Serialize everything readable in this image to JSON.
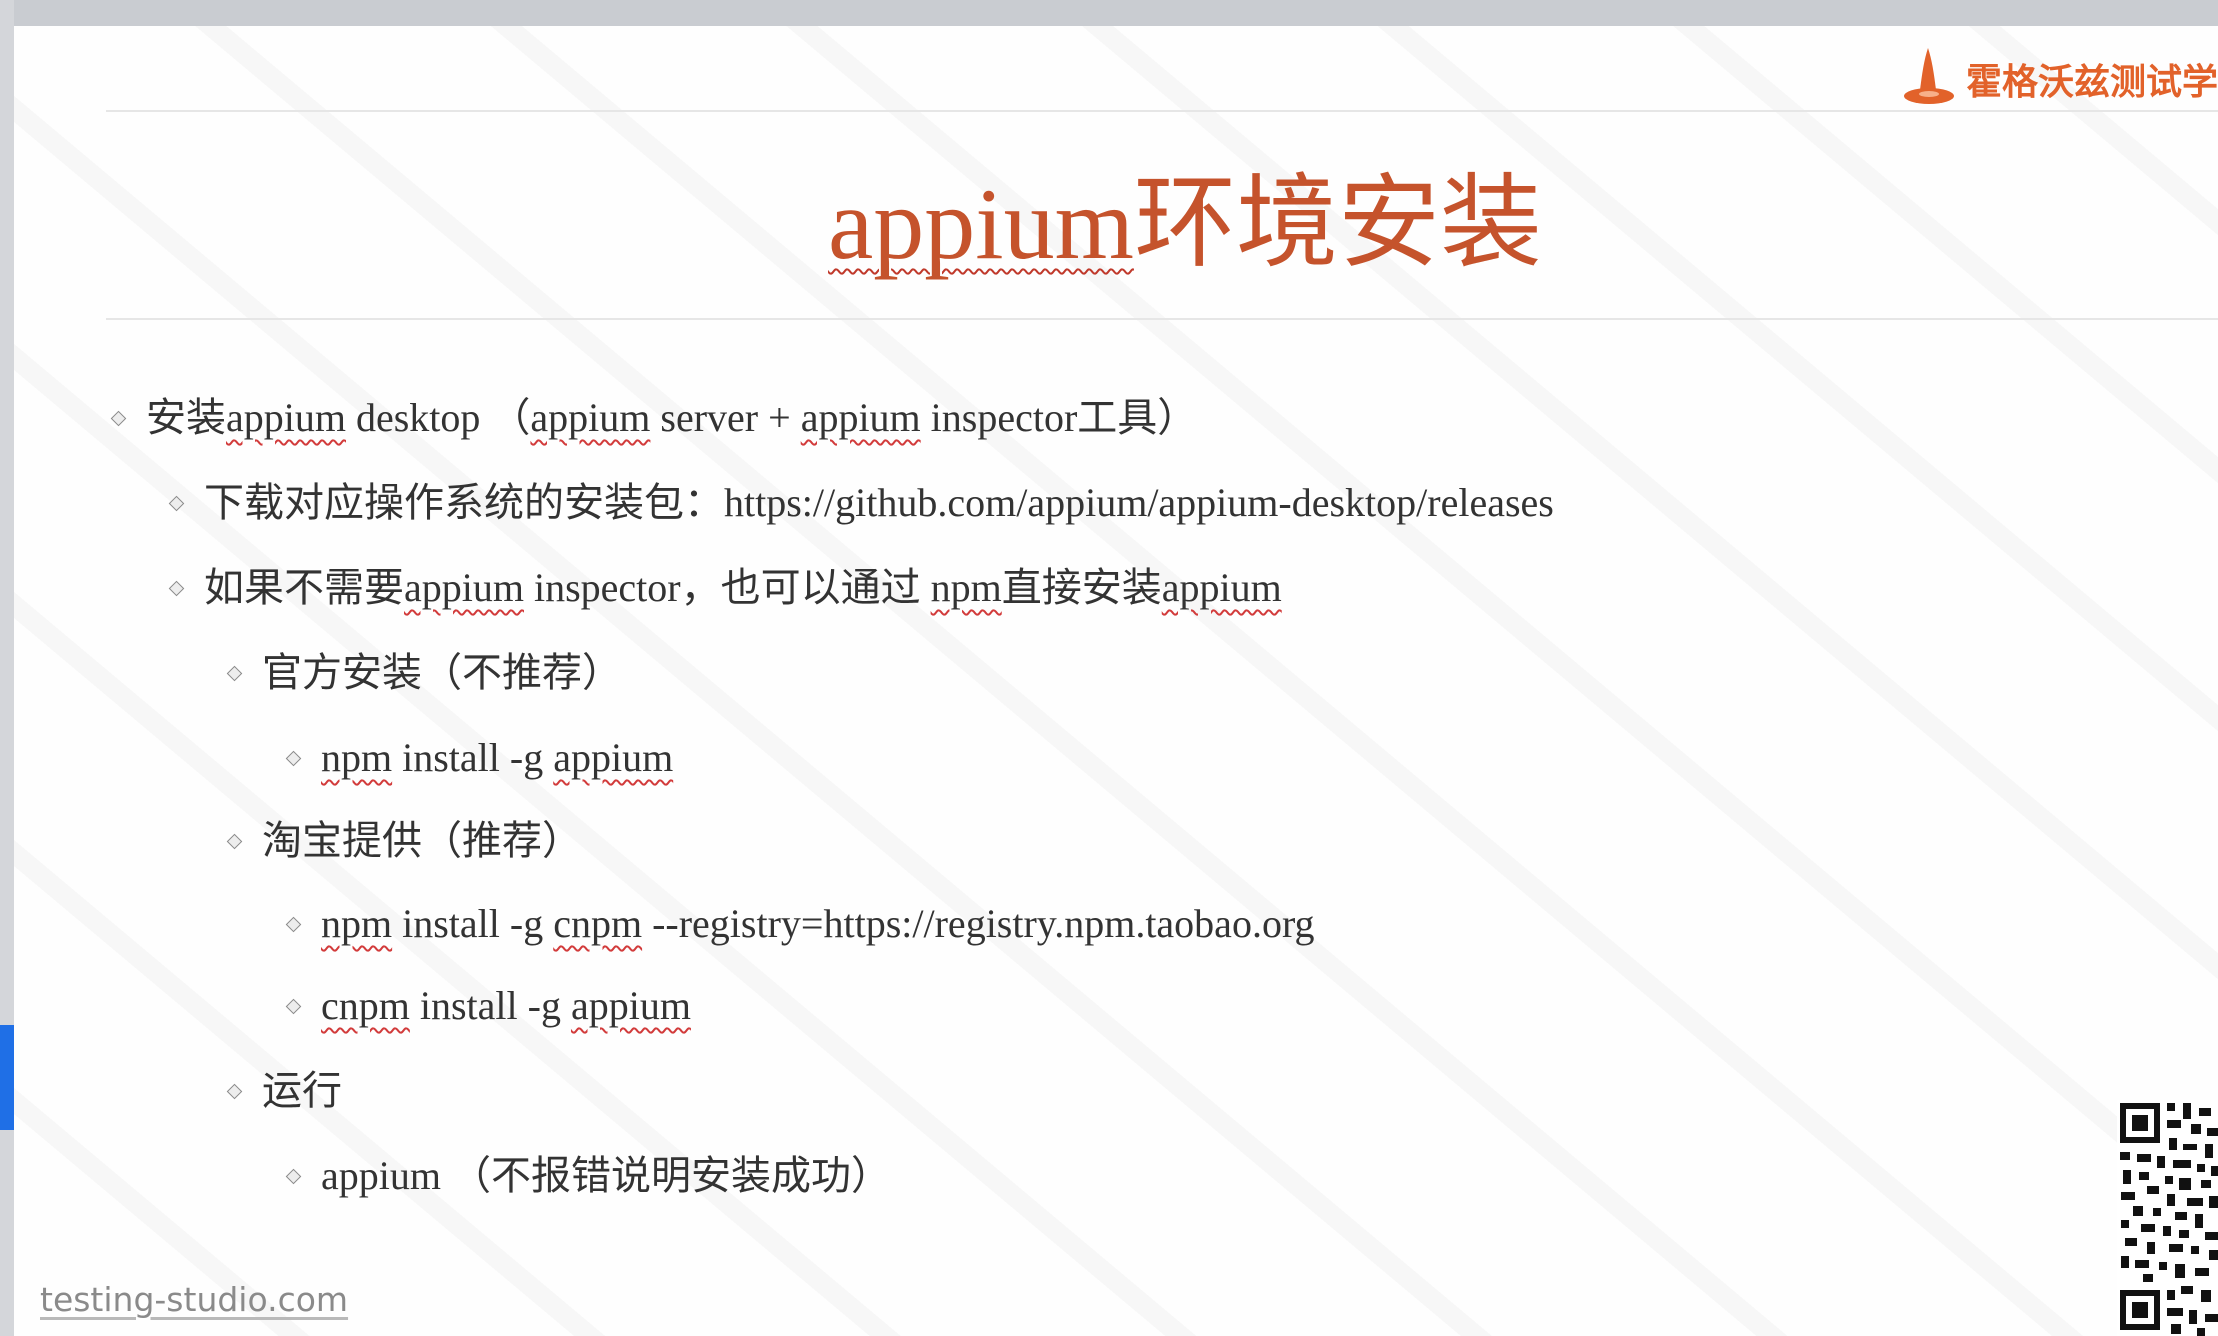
{
  "brand": {
    "name": "霍格沃兹测试学"
  },
  "slide": {
    "title_prefix": "appium",
    "title_suffix": "环境安装"
  },
  "bullets": [
    {
      "level": 1,
      "parts": [
        {
          "t": "安装",
          "s": false
        },
        {
          "t": "appium",
          "s": true
        },
        {
          "t": " desktop （",
          "s": false
        },
        {
          "t": "appium",
          "s": true
        },
        {
          "t": " server + ",
          "s": false
        },
        {
          "t": "appium",
          "s": true
        },
        {
          "t": " inspector工具）",
          "s": false
        }
      ]
    },
    {
      "level": 2,
      "parts": [
        {
          "t": "下载对应操作系统的安装包：https://github.com/appium/appium-desktop/releases",
          "s": false
        }
      ]
    },
    {
      "level": 2,
      "parts": [
        {
          "t": "如果不需要",
          "s": false
        },
        {
          "t": "appium",
          "s": true
        },
        {
          "t": " inspector，也可以通过 ",
          "s": false
        },
        {
          "t": "npm",
          "s": true
        },
        {
          "t": "直接安装",
          "s": false
        },
        {
          "t": "appium",
          "s": true
        }
      ]
    },
    {
      "level": 3,
      "parts": [
        {
          "t": "官方安装（不推荐）",
          "s": false
        }
      ]
    },
    {
      "level": 4,
      "parts": [
        {
          "t": "npm",
          "s": true
        },
        {
          "t": " install -g ",
          "s": false
        },
        {
          "t": "appium",
          "s": true
        }
      ]
    },
    {
      "level": 3,
      "parts": [
        {
          "t": "淘宝提供（推荐）",
          "s": false
        }
      ]
    },
    {
      "level": 4,
      "parts": [
        {
          "t": "npm",
          "s": true
        },
        {
          "t": " install -g ",
          "s": false
        },
        {
          "t": "cnpm",
          "s": true
        },
        {
          "t": " --registry=https://registry.npm.taobao.org",
          "s": false
        }
      ]
    },
    {
      "level": 4,
      "parts": [
        {
          "t": "cnpm",
          "s": true
        },
        {
          "t": " install -g ",
          "s": false
        },
        {
          "t": "appium",
          "s": true
        }
      ]
    },
    {
      "level": 3,
      "parts": [
        {
          "t": "运行",
          "s": false
        }
      ]
    },
    {
      "level": 4,
      "parts": [
        {
          "t": "appium （不报错说明安装成功）",
          "s": false
        }
      ]
    }
  ],
  "footer": {
    "site": "testing-studio.com"
  },
  "colors": {
    "accent": "#c5532c",
    "brand": "#e2622a",
    "text": "#333333"
  }
}
